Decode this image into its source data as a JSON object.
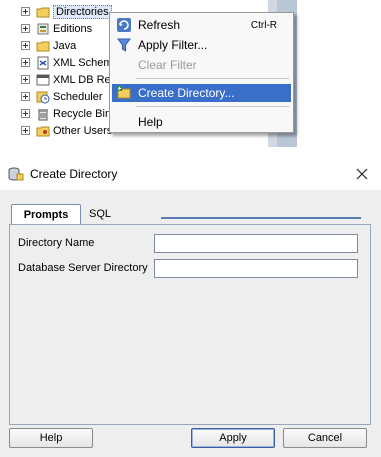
{
  "tree": {
    "items": [
      {
        "label": "Directories",
        "icon": "folder-icon",
        "selected": true
      },
      {
        "label": "Editions",
        "icon": "editions-icon"
      },
      {
        "label": "Java",
        "icon": "java-icon"
      },
      {
        "label": "XML Schem",
        "icon": "xml-schema-icon"
      },
      {
        "label": "XML DB Rep",
        "icon": "xml-db-icon"
      },
      {
        "label": "Scheduler",
        "icon": "scheduler-icon"
      },
      {
        "label": "Recycle Bin",
        "icon": "recycle-bin-icon"
      },
      {
        "label": "Other Users",
        "icon": "users-icon"
      }
    ]
  },
  "context_menu": {
    "items": [
      {
        "label": "Refresh",
        "shortcut": "Ctrl-R",
        "icon": "refresh-icon",
        "enabled": true
      },
      {
        "label": "Apply Filter...",
        "icon": "filter-icon",
        "enabled": true
      },
      {
        "label": "Clear Filter",
        "enabled": false
      },
      {
        "label": "Create Directory...",
        "icon": "create-directory-icon",
        "enabled": true,
        "highlighted": true
      },
      {
        "label": "Help",
        "enabled": true
      }
    ]
  },
  "dialog": {
    "title": "Create Directory",
    "tabs": [
      {
        "label": "Prompts",
        "active": true
      },
      {
        "label": "SQL",
        "active": false
      }
    ],
    "fields": [
      {
        "label": "Directory Name",
        "value": ""
      },
      {
        "label": "Database Server Directory",
        "value": ""
      }
    ],
    "buttons": {
      "help": "Help",
      "apply": "Apply",
      "cancel": "Cancel"
    }
  },
  "colors": {
    "menu_highlight": "#3a6fc9",
    "tab_underline": "#5a7db5",
    "dialog_body": "#eeeeee"
  }
}
